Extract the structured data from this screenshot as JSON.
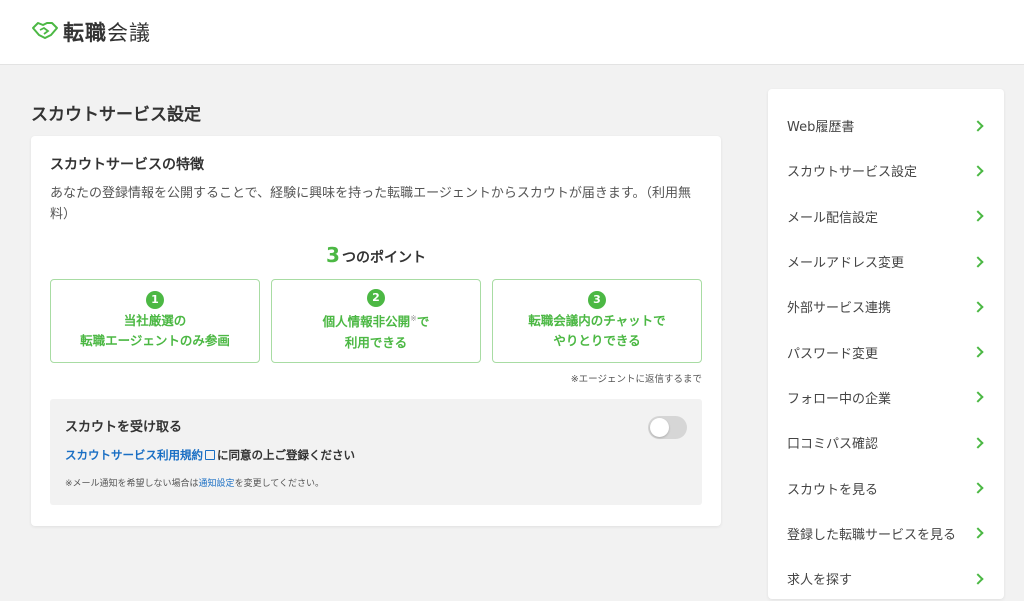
{
  "header": {
    "logo_bold": "転職",
    "logo_light": "会議"
  },
  "page_title": "スカウトサービス設定",
  "card": {
    "title": "スカウトサービスの特徴",
    "description": "あなたの登録情報を公開することで、経験に興味を持った転職エージェントからスカウトが届きます。（利用無料）",
    "points_number": "3",
    "points_title": "つのポイント",
    "points": [
      {
        "num": "1",
        "line1": "当社厳選の",
        "line2": "転職エージェントのみ参画",
        "sup": ""
      },
      {
        "num": "2",
        "line1": "個人情報非公開",
        "line2": "利用できる",
        "sup": "※",
        "line1_suffix": "で"
      },
      {
        "num": "3",
        "line1": "転職会議内のチャットで",
        "line2": "やりとりできる",
        "sup": ""
      }
    ],
    "points_note": "※エージェントに返信するまで",
    "scout": {
      "label": "スカウトを受け取る",
      "toggle_on": false,
      "terms_link": "スカウトサービス利用規約",
      "terms_suffix": "に同意の上ご登録ください",
      "note_prefix": "※メール通知を希望しない場合は",
      "note_link": "通知設定",
      "note_suffix": "を変更してください。"
    }
  },
  "sidebar": {
    "items": [
      {
        "label": "Web履歴書"
      },
      {
        "label": "スカウトサービス設定"
      },
      {
        "label": "メール配信設定"
      },
      {
        "label": "メールアドレス変更"
      },
      {
        "label": "外部サービス連携"
      },
      {
        "label": "パスワード変更"
      },
      {
        "label": "フォロー中の企業"
      },
      {
        "label": "口コミパス確認"
      },
      {
        "label": "スカウトを見る"
      },
      {
        "label": "登録した転職サービスを見る"
      },
      {
        "label": "求人を探す"
      }
    ]
  },
  "colors": {
    "accent": "#4cb844",
    "link": "#1a6fc4"
  }
}
